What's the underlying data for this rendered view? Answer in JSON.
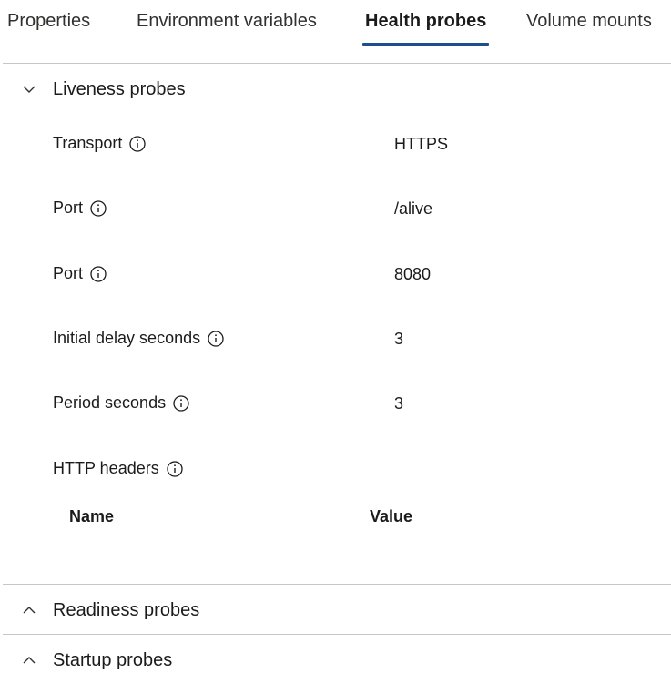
{
  "tabs": [
    {
      "label": "Properties",
      "active": false
    },
    {
      "label": "Environment variables",
      "active": false
    },
    {
      "label": "Health probes",
      "active": true
    },
    {
      "label": "Volume mounts",
      "active": false
    }
  ],
  "liveness": {
    "title": "Liveness probes",
    "expanded": true,
    "properties": [
      {
        "label": "Transport",
        "value": "HTTPS",
        "icon": "info-icon"
      },
      {
        "label": "Port",
        "value": "/alive",
        "icon": "info-icon"
      },
      {
        "label": "Port",
        "value": "8080",
        "icon": "info-icon"
      },
      {
        "label": "Initial delay seconds",
        "value": "3",
        "icon": "info-icon"
      },
      {
        "label": "Period seconds",
        "value": "3",
        "icon": "info-icon"
      }
    ],
    "http_headers": {
      "label": "HTTP headers",
      "columns": [
        "Name",
        "Value"
      ]
    }
  },
  "readiness": {
    "title": "Readiness probes",
    "expanded": false
  },
  "startup": {
    "title": "Startup probes",
    "expanded": false
  },
  "colors": {
    "active_underline": "#1f4e8c",
    "divider": "#c8c6c4"
  }
}
